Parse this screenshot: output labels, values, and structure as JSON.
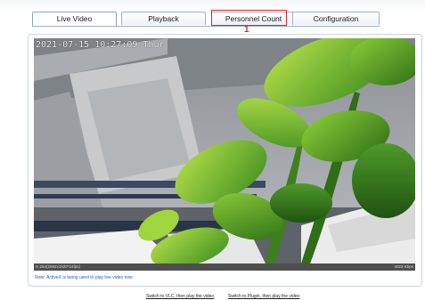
{
  "tabs": [
    {
      "label": "Live Video",
      "active": true
    },
    {
      "label": "Playback",
      "active": false
    },
    {
      "label": "Personnel Count",
      "active": false,
      "highlighted": true
    },
    {
      "label": "Configuration",
      "active": false
    }
  ],
  "annotation": {
    "marker": "1",
    "color": "#e0262a"
  },
  "video": {
    "osd_timestamp": "2021-07-15 10:27:09 Thur",
    "status_left": "H.264(2592x1520*24fps)",
    "status_right": "4023 Kbps"
  },
  "note": "Note: ActiveX is being used to play live video now",
  "links": {
    "vlc": "Switch to VLC, then play the video",
    "plugin": "Switch to Plugin, then play the video"
  },
  "colors": {
    "tab_border": "#9fb1c3",
    "note_text": "#2b5ba8",
    "highlight": "#e0262a"
  }
}
